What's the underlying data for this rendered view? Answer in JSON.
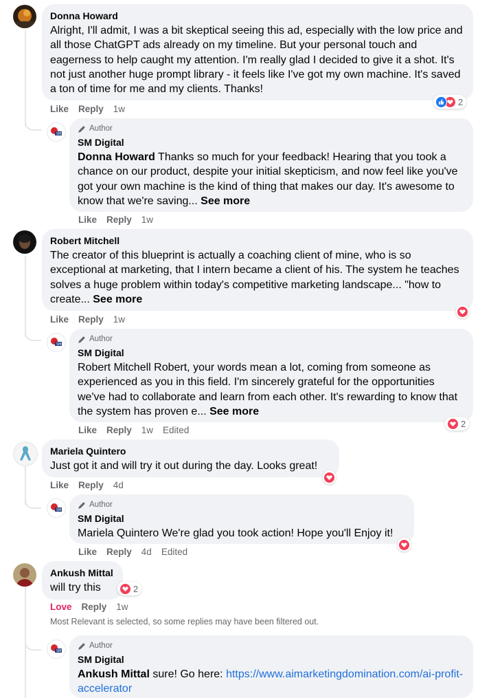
{
  "c1": {
    "name": "Donna Howard",
    "text": "Alright, I'll admit, I was a bit skeptical seeing this ad, especially with the low price and all those ChatGPT ads already on my timeline. But your personal touch and eagerness to help caught my attention. I'm really glad I decided to give it a shot. It's not just another huge prompt library - it feels like I've got my own machine. It's saved a ton of time for me and my clients. Thanks!",
    "like": "Like",
    "reply": "Reply",
    "time": "1w",
    "reactions": "2"
  },
  "r1": {
    "author_badge": "Author",
    "name": "SM Digital",
    "tag": "Donna Howard",
    "text": " Thanks so much for your feedback! Hearing that you took a chance on our product, despite your initial skepticism, and now feel like you've got your own machine is the kind of thing that makes our day. It's awesome to know that we're saving... ",
    "see_more": "See more",
    "like": "Like",
    "reply": "Reply",
    "time": "1w"
  },
  "c2": {
    "name": "Robert Mitchell",
    "text": "The creator of this blueprint is actually a coaching client of mine, who is so exceptional at marketing, that I intern became a client of his. The system he teaches solves a huge problem within today's competitive marketing landscape... \"how to create... ",
    "see_more": "See more",
    "like": "Like",
    "reply": "Reply",
    "time": "1w"
  },
  "r2": {
    "author_badge": "Author",
    "name": "SM Digital",
    "text": "Robert Mitchell Robert, your words mean a lot, coming from someone as experienced as you in this field. I'm sincerely grateful for the opportunities we've had to collaborate and learn from each other. It's rewarding to know that the system has proven e... ",
    "see_more": "See more",
    "like": "Like",
    "reply": "Reply",
    "time": "1w",
    "edited": "Edited",
    "reactions": "2"
  },
  "c3": {
    "name": "Mariela Quintero",
    "text": "Just got it and will try it out during the day. Looks great!",
    "like": "Like",
    "reply": "Reply",
    "time": "4d"
  },
  "r3": {
    "author_badge": "Author",
    "name": "SM Digital",
    "text": "Mariela Quintero We're glad you took action! Hope you'll Enjoy it!",
    "like": "Like",
    "reply": "Reply",
    "time": "4d",
    "edited": "Edited"
  },
  "c4": {
    "name": "Ankush Mittal",
    "text": "will try this",
    "love": "Love",
    "reply": "Reply",
    "time": "1w",
    "reactions": "2"
  },
  "filter_note": "Most Relevant is selected, so some replies may have been filtered out.",
  "r4": {
    "author_badge": "Author",
    "name": "SM Digital",
    "tag": "Ankush Mittal",
    "text": " sure! Go here: ",
    "link": "https://www.aimarketingdomination.com/ai-profit-accelerator"
  },
  "colors": {
    "bubble": "#f0f2f5",
    "link": "#216fdb",
    "love": "#f33e58",
    "like": "#1877f2",
    "meta": "#65676b"
  }
}
